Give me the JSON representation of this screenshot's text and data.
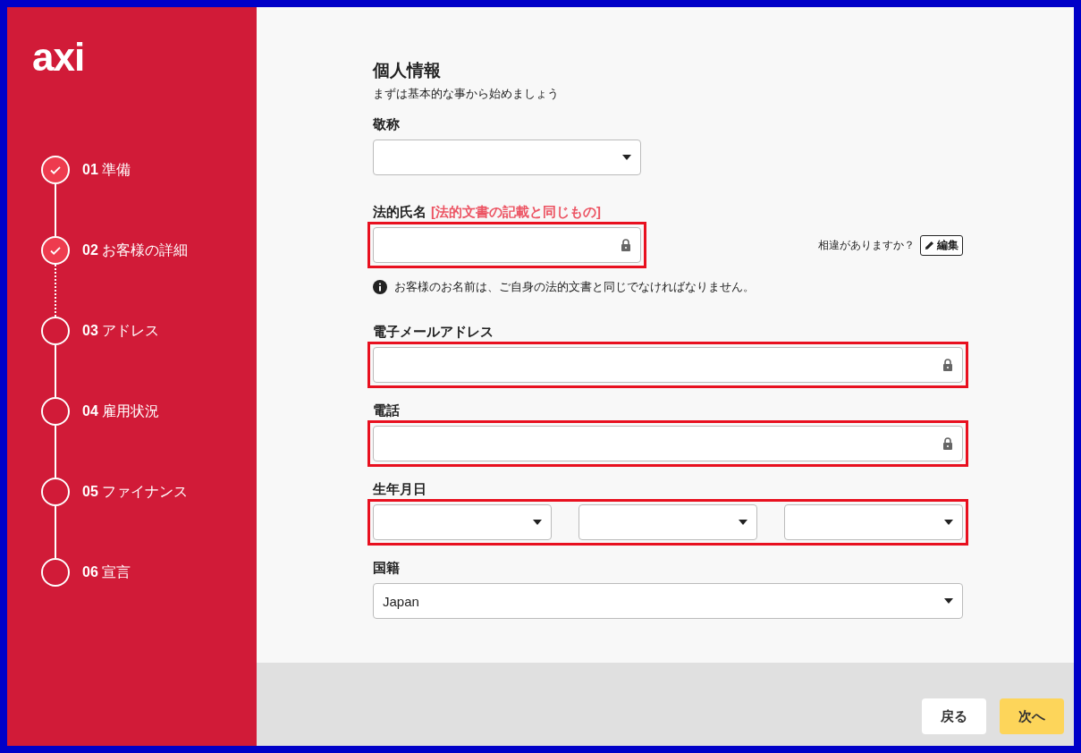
{
  "logo": "axi",
  "steps": [
    {
      "number": "01",
      "label": "準備",
      "completed": true
    },
    {
      "number": "02",
      "label": "お客様の詳細",
      "completed": true
    },
    {
      "number": "03",
      "label": "アドレス",
      "completed": false
    },
    {
      "number": "04",
      "label": "雇用状況",
      "completed": false
    },
    {
      "number": "05",
      "label": "ファイナンス",
      "completed": false
    },
    {
      "number": "06",
      "label": "宣言",
      "completed": false
    }
  ],
  "heading": "個人情報",
  "subheading": "まずは基本的な事から始めましょう",
  "fields": [
    {
      "kind": "short-select",
      "label": "敬称",
      "highlighted": false
    },
    {
      "kind": "name-input",
      "label": "法的氏名",
      "label_note": "[法的文書の記載と同じもの]",
      "locked": true,
      "highlighted": true,
      "mismatch_prompt": "相違がありますか？",
      "edit_button": "編集",
      "hint": "お客様のお名前は、ご自身の法的文書と同じでなければなりません。"
    },
    {
      "kind": "input",
      "label": "電子メールアドレス",
      "locked": true,
      "highlighted": true
    },
    {
      "kind": "input",
      "label": "電話",
      "locked": true,
      "highlighted": true
    },
    {
      "kind": "date",
      "label": "生年月日",
      "highlighted": true
    },
    {
      "kind": "select",
      "label": "国籍",
      "value": "Japan",
      "highlighted": false
    }
  ],
  "buttons": {
    "back": "戻る",
    "next": "次へ"
  }
}
